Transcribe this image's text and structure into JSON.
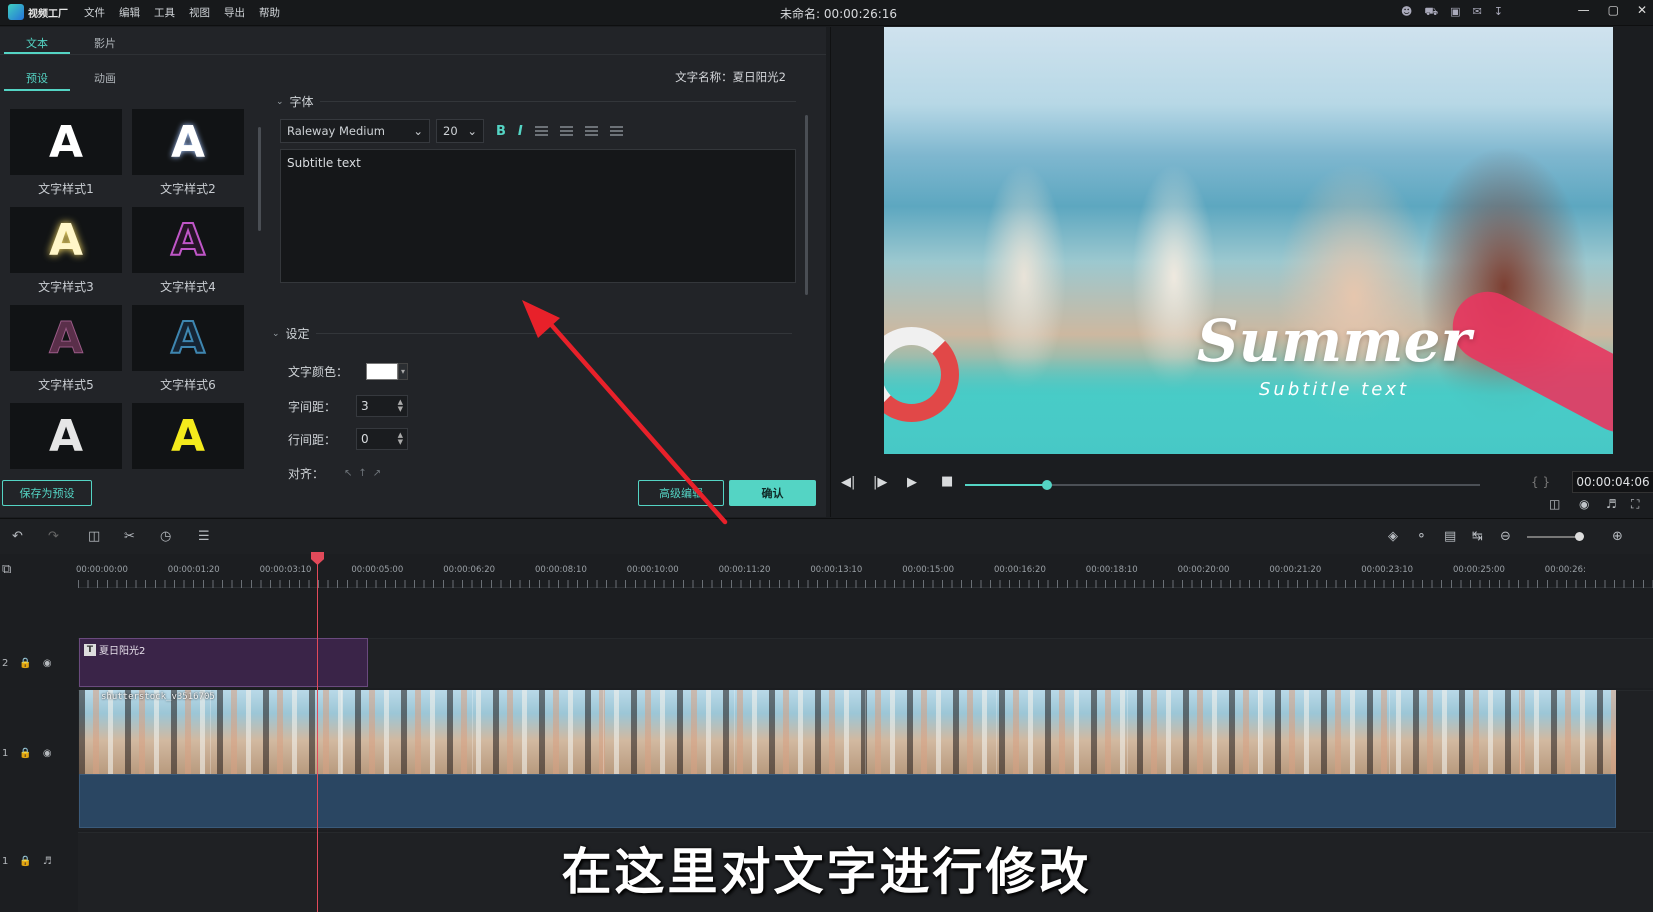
{
  "app": {
    "logo_text": "视频工厂",
    "menu": [
      "文件",
      "编辑",
      "工具",
      "视图",
      "导出",
      "帮助"
    ],
    "project_title": "未命名: 00:00:26:16"
  },
  "left_panel": {
    "tabs": [
      "文本",
      "影片"
    ],
    "subtabs": [
      "预设",
      "动画"
    ],
    "text_name": "文字名称：夏日阳光2",
    "presets": [
      "文字样式1",
      "文字样式2",
      "文字样式3",
      "文字样式4",
      "文字样式5",
      "文字样式6"
    ],
    "preset_glyph": "A",
    "font_section": "字体",
    "font_family": "Raleway Medium",
    "font_size": "20",
    "bold_label": "B",
    "italic_label": "I",
    "text_content": "Subtitle text",
    "settings_section": "设定",
    "text_color_label": "文字颜色：",
    "char_spacing_label": "字间距：",
    "char_spacing_value": "3",
    "line_spacing_label": "行间距：",
    "line_spacing_value": "0",
    "align_label": "对齐：",
    "save_preset_button": "保存为预设",
    "advanced_edit_button": "高级编辑",
    "confirm_button": "确认"
  },
  "preview": {
    "video_title": "Summer",
    "video_subtitle": "Subtitle text",
    "timecode": "00:00:04:06",
    "progress": 0.16,
    "brackets": "{ }"
  },
  "timeline": {
    "ruler_labels": [
      "00:00:00:00",
      "00:00:01:20",
      "00:00:03:10",
      "00:00:05:00",
      "00:00:06:20",
      "00:00:08:10",
      "00:00:10:00",
      "00:00:11:20",
      "00:00:13:10",
      "00:00:15:00",
      "00:00:16:20",
      "00:00:18:10",
      "00:00:20:00",
      "00:00:21:20",
      "00:00:23:10",
      "00:00:25:00",
      "00:00:26:"
    ],
    "track2_label": "2",
    "track1_label": "1",
    "audio_track_label": "1",
    "title_clip_name": "夏日阳光2",
    "title_clip_icon": "T",
    "video_clip_name": "shutterstock_v3516705"
  },
  "caption": "在这里对文字进行修改",
  "colors": {
    "accent": "#54d4c4",
    "arrow": "#e8212a",
    "playhead": "#e14a5a",
    "title_clip": "#3a2448"
  }
}
